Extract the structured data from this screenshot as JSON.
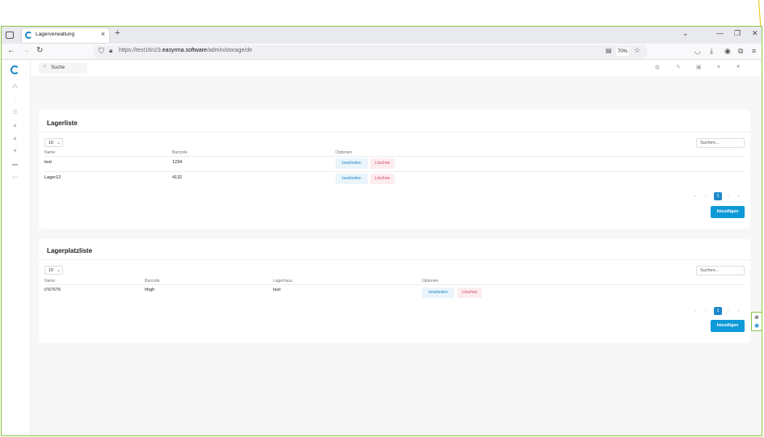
{
  "browser": {
    "tab_title": "Lagerverwaltung",
    "tab_close": "×",
    "new_tab": "+",
    "url_prefix": "https://test16n23.",
    "url_host": "easyrma.software",
    "url_path": "/admin/storage/de",
    "zoom": "70%"
  },
  "app": {
    "search_label": "Suche",
    "storage_list": {
      "title": "Lagerliste",
      "page_size": "10",
      "search_placeholder": "Suchen...",
      "columns": [
        "Name",
        "Barcode",
        "Optionen"
      ],
      "rows": [
        {
          "name": "test",
          "barcode": "1234"
        },
        {
          "name": "Lager12",
          "barcode": "4132"
        }
      ],
      "edit_label": "bearbeiten",
      "delete_label": "Löschen",
      "pagination": {
        "first": "«",
        "prev": "‹",
        "current": "1",
        "next": "›",
        "last": "»"
      },
      "add_label": "hinzufügen"
    },
    "location_list": {
      "title": "Lagerplatzliste",
      "page_size": "10",
      "search_placeholder": "Suchen...",
      "columns": [
        "Name",
        "Barcode",
        "Lagerhaus",
        "Optionen"
      ],
      "rows": [
        {
          "name": "t767676",
          "barcode": "hhgh",
          "warehouse": "test"
        }
      ],
      "edit_label": "bearbeiten",
      "delete_label": "Löschen",
      "pagination": {
        "first": "«",
        "prev": "‹",
        "current": "1",
        "next": "›",
        "last": "»"
      },
      "add_label": "hinzufügen"
    }
  }
}
